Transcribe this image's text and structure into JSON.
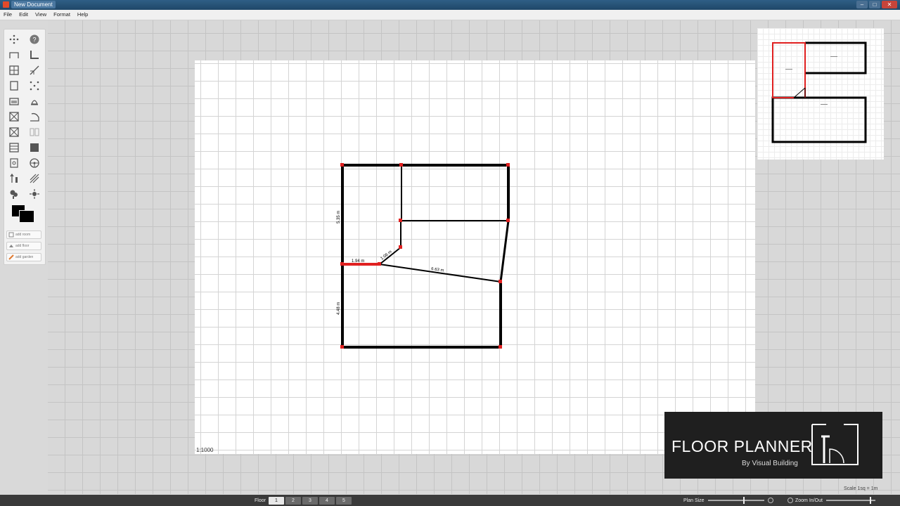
{
  "window": {
    "title": "New Document"
  },
  "menu": [
    "File",
    "Edit",
    "View",
    "Format",
    "Help"
  ],
  "toolbox": {
    "tools": [
      {
        "name": "select-tool-icon"
      },
      {
        "name": "help-icon"
      },
      {
        "name": "wall-tool-icon"
      },
      {
        "name": "corner-wall-icon"
      },
      {
        "name": "window-tool-icon"
      },
      {
        "name": "line-tool-icon"
      },
      {
        "name": "door-tool-icon"
      },
      {
        "name": "points-tool-icon"
      },
      {
        "name": "sofa-tool-icon"
      },
      {
        "name": "lamp-tool-icon"
      },
      {
        "name": "table-tool-icon"
      },
      {
        "name": "arc-tool-icon"
      },
      {
        "name": "bed-tool-icon"
      },
      {
        "name": "grid-tool-icon"
      },
      {
        "name": "cabinet-tool-icon"
      },
      {
        "name": "fill-tool-icon"
      },
      {
        "name": "appliance-tool-icon"
      },
      {
        "name": "steering-tool-icon"
      },
      {
        "name": "person-tool-icon"
      },
      {
        "name": "hatch-tool-icon"
      },
      {
        "name": "plant-tool-icon"
      },
      {
        "name": "light-tool-icon"
      }
    ],
    "add_buttons": [
      "add room",
      "add floor",
      "add garden"
    ]
  },
  "canvas": {
    "scale_ratio": "1:1000",
    "measurements": {
      "left_upper": "5.35 m",
      "left_lower": "4.48 m",
      "bottom_wall": "1.94 m",
      "diagonal_short": "1.06 m",
      "diagonal_long": "6.63 m"
    }
  },
  "logo": {
    "brand": "FLOOR PLANNER",
    "sub": "By Visual Building"
  },
  "scale_legend": "Scale 1sq = 1m",
  "status": {
    "floor_label": "Floor",
    "floors": [
      "1",
      "2",
      "3",
      "4",
      "5"
    ],
    "active_floor": "1",
    "plan_size_label": "Plan Size",
    "zoom_label": "Zoom In/Out"
  },
  "colors": {
    "wall": "#000000",
    "selected_wall": "#e02020",
    "titlebar": "#2f5f86"
  }
}
